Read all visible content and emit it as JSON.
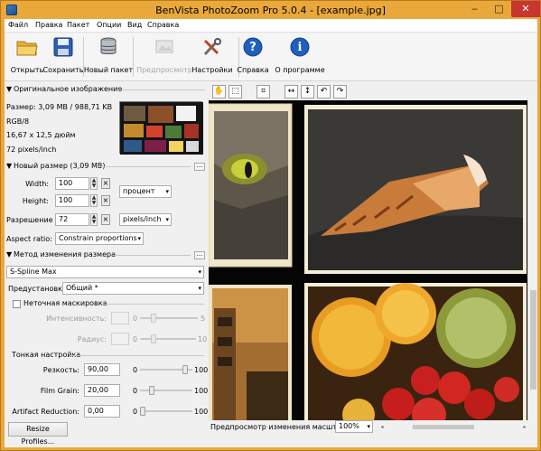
{
  "window": {
    "title": "BenVista PhotoZoom Pro 5.0.4 - [example.jpg]",
    "minimize": "‒",
    "maximize": "□",
    "close": "✕"
  },
  "menu": [
    "Файл",
    "Правка",
    "Пакет",
    "Опции",
    "Вид",
    "Справка"
  ],
  "toolbar": {
    "open": "Открыть",
    "save": "Сохранить",
    "batch": "Новый пакет",
    "preview": "Предпросмотр",
    "settings": "Настройки",
    "help": "Справка",
    "about": "О программе"
  },
  "original": {
    "header": "Оригинальное изображение",
    "size": "Размер: 3,09 MB / 988,71 KB",
    "mode": "RGB/8",
    "dims": "16,67 x 12,5 дюйм",
    "res": "72 pixels/inch"
  },
  "newsize": {
    "header": "Новый размер (3,09 MB)",
    "width_label": "Width:",
    "width": "100",
    "height_label": "Height:",
    "height": "100",
    "unit": "процент",
    "res_label": "Разрешение",
    "res": "72",
    "res_unit": "pixels/inch",
    "aspect_label": "Aspect ratio:",
    "aspect": "Constrain proportions",
    "ellipsis": "..."
  },
  "method": {
    "header": "Метод изменения размера",
    "algorithm": "S-Spline Max",
    "preset_label": "Предустановка:",
    "preset": "Общий *",
    "ellipsis": "..."
  },
  "unsharp": {
    "label": "Неточная маскировка",
    "intensity_label": "Интенсивность:",
    "intensity_min": "0",
    "intensity_max": "5",
    "radius_label": "Радиус:",
    "radius_min": "0",
    "radius_max": "10"
  },
  "fine": {
    "header": "Тонкая настройка",
    "sharpness_label": "Резкость:",
    "sharpness": "90,00",
    "sharpness_min": "0",
    "sharpness_max": "100",
    "sharpness_level": 0.9,
    "grain_label": "Film Grain:",
    "grain": "20,00",
    "grain_min": "0",
    "grain_max": "100",
    "grain_level": 0.2,
    "artifact_label": "Artifact Reduction:",
    "artifact": "0,00",
    "artifact_min": "0",
    "artifact_max": "100",
    "artifact_level": 0.0
  },
  "resize_profiles": "Resize Profiles...",
  "status": {
    "label": "Предпросмотр изменения масштаба:",
    "zoom": "100%"
  },
  "viewtools": {
    "hand": "✋",
    "select": "⬚",
    "crop": "⌗",
    "flip_h": "↔",
    "flip_v": "↕",
    "rot_l": "↶",
    "rot_r": "↷"
  }
}
